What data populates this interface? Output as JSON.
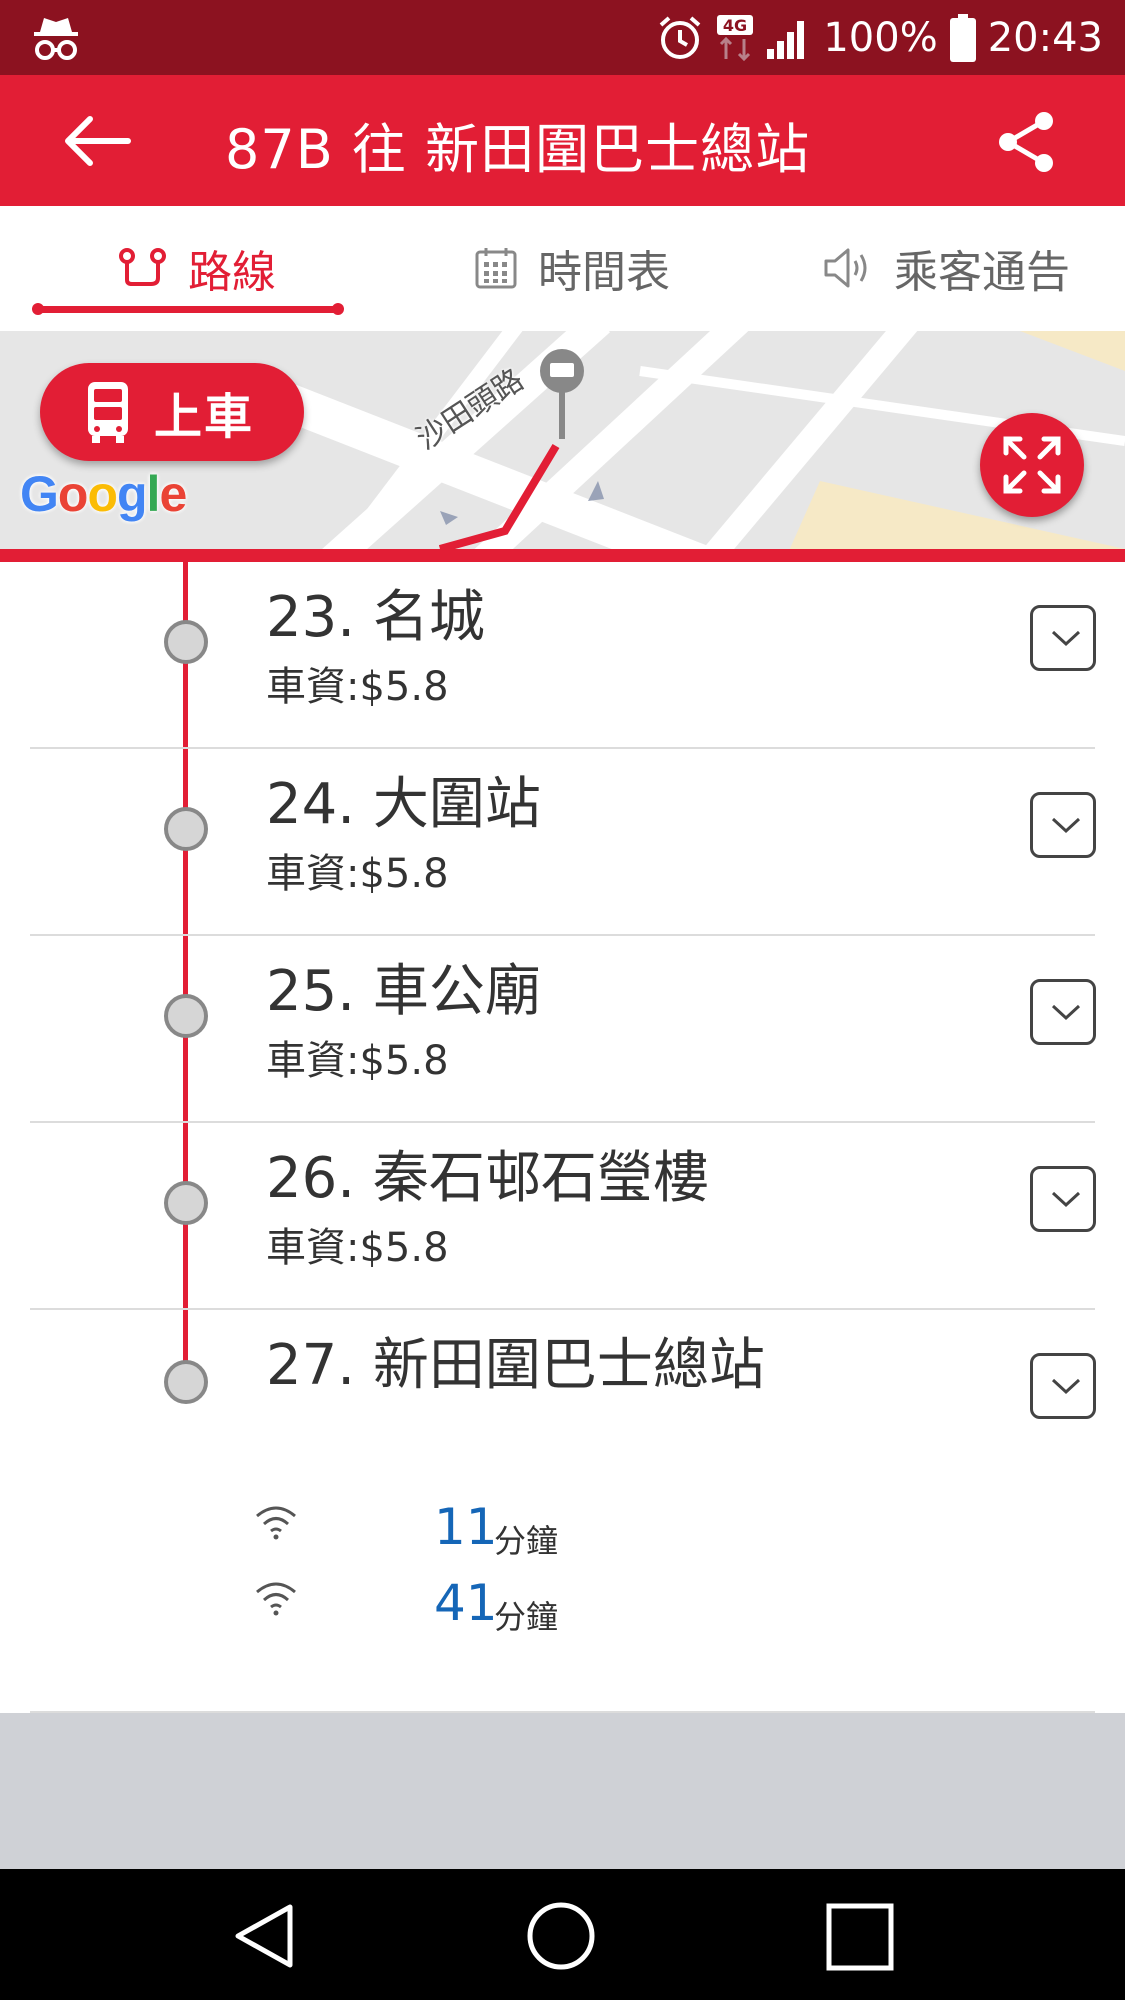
{
  "status_bar": {
    "battery_text": "100%",
    "time": "20:43",
    "network": "4G"
  },
  "app_bar": {
    "title": "87B 往 新田圍巴士總站"
  },
  "tabs": [
    {
      "label": "路線",
      "icon": "route-icon",
      "active": true
    },
    {
      "label": "時間表",
      "icon": "calendar-icon",
      "active": false
    },
    {
      "label": "乘客通告",
      "icon": "speaker-icon",
      "active": false
    }
  ],
  "map": {
    "board_button": "上車",
    "road_label": "沙田頭路",
    "google": [
      "G",
      "o",
      "o",
      "g",
      "l",
      "e"
    ]
  },
  "stops": [
    {
      "name": "23. 名城",
      "fare": "車資:$5.8"
    },
    {
      "name": "24. 大圍站",
      "fare": "車資:$5.8"
    },
    {
      "name": "25. 車公廟",
      "fare": "車資:$5.8"
    },
    {
      "name": "26. 秦石邨石瑩樓",
      "fare": "車資:$5.8"
    },
    {
      "name": "27. 新田圍巴士總站",
      "fare": ""
    }
  ],
  "eta": [
    {
      "minutes": "11",
      "unit": "分鐘"
    },
    {
      "minutes": "41",
      "unit": "分鐘"
    }
  ],
  "colors": {
    "brand_red": "#e21e35",
    "status_bar": "#8c1220",
    "eta_blue": "#1566b7"
  }
}
